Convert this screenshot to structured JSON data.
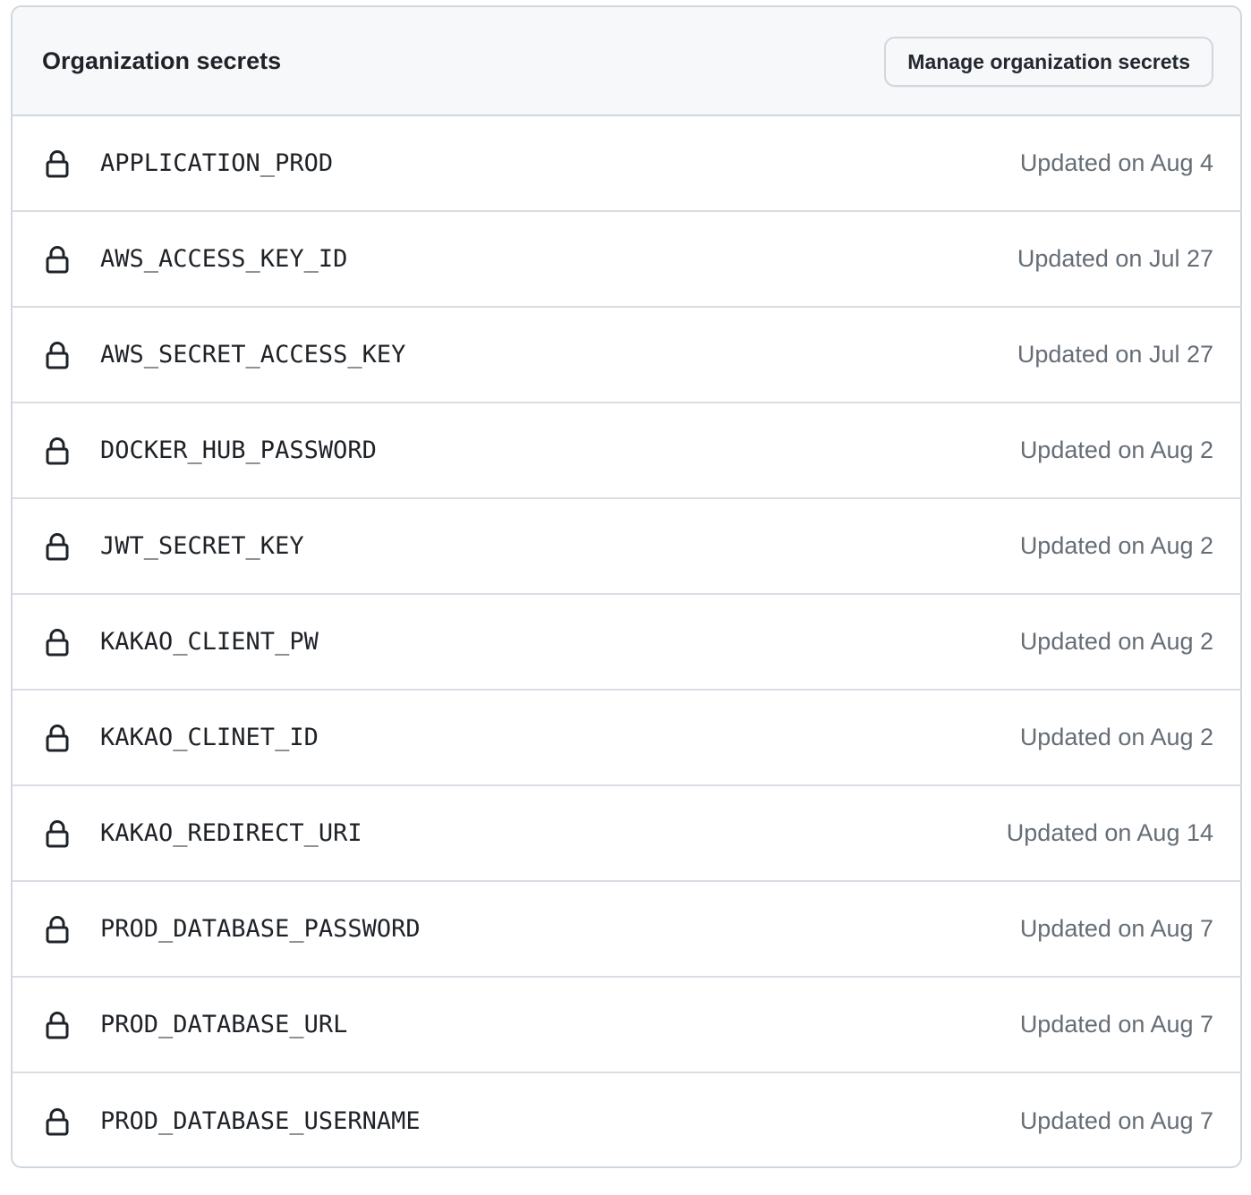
{
  "header": {
    "title": "Organization secrets",
    "manage_button_label": "Manage organization secrets"
  },
  "secrets": [
    {
      "name": "APPLICATION_PROD",
      "updated": "Updated on Aug 4",
      "icon": "lock-icon"
    },
    {
      "name": "AWS_ACCESS_KEY_ID",
      "updated": "Updated on Jul 27",
      "icon": "lock-icon"
    },
    {
      "name": "AWS_SECRET_ACCESS_KEY",
      "updated": "Updated on Jul 27",
      "icon": "lock-icon"
    },
    {
      "name": "DOCKER_HUB_PASSWORD",
      "updated": "Updated on Aug 2",
      "icon": "lock-icon"
    },
    {
      "name": "JWT_SECRET_KEY",
      "updated": "Updated on Aug 2",
      "icon": "lock-icon"
    },
    {
      "name": "KAKAO_CLIENT_PW",
      "updated": "Updated on Aug 2",
      "icon": "lock-icon"
    },
    {
      "name": "KAKAO_CLINET_ID",
      "updated": "Updated on Aug 2",
      "icon": "lock-icon"
    },
    {
      "name": "KAKAO_REDIRECT_URI",
      "updated": "Updated on Aug 14",
      "icon": "lock-icon"
    },
    {
      "name": "PROD_DATABASE_PASSWORD",
      "updated": "Updated on Aug 7",
      "icon": "lock-icon"
    },
    {
      "name": "PROD_DATABASE_URL",
      "updated": "Updated on Aug 7",
      "icon": "lock-icon"
    },
    {
      "name": "PROD_DATABASE_USERNAME",
      "updated": "Updated on Aug 7",
      "icon": "lock-icon"
    }
  ],
  "colors": {
    "text_primary": "#1f2328",
    "text_muted": "#656d76",
    "header_bg": "#f6f8fa",
    "border": "#d0d7de"
  }
}
